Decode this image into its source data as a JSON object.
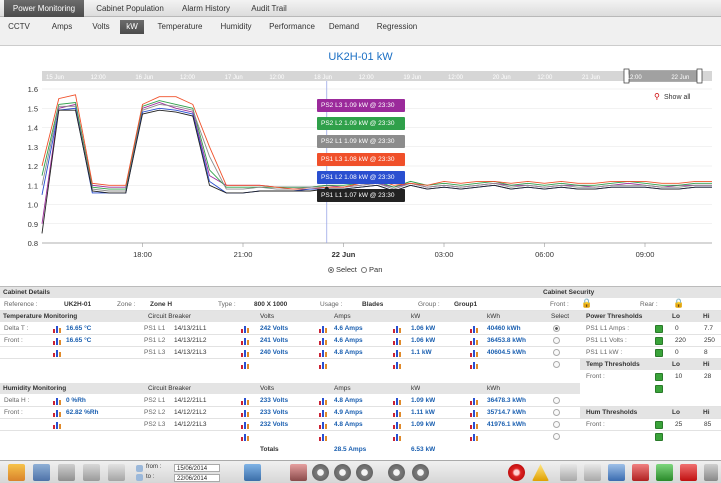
{
  "top_tabs": [
    {
      "label": "Power Monitoring",
      "active": true
    },
    {
      "label": "Cabinet Population"
    },
    {
      "label": "Alarm History"
    },
    {
      "label": "Audit Trail"
    }
  ],
  "sub_tabs": [
    {
      "label": "CCTV"
    },
    {
      "label": "Amps"
    },
    {
      "label": "Volts"
    },
    {
      "label": "kW",
      "active": true
    },
    {
      "label": "Temperature"
    },
    {
      "label": "Humidity"
    },
    {
      "label": "Performance"
    },
    {
      "label": "Demand"
    },
    {
      "label": "Regression"
    }
  ],
  "chart": {
    "title": "UK2H-01 kW",
    "show_all": "Show all",
    "select_label": "Select",
    "pan_label": "Pan",
    "tooltips": [
      {
        "text": "PS2 L3 1.09 kW @ 23:30",
        "color": "#9b2a9b"
      },
      {
        "text": "PS2 L2 1.09 kW @ 23:30",
        "color": "#2fa04a"
      },
      {
        "text": "PS2 L1 1.09 kW @ 23:30",
        "color": "#8c8c8c"
      },
      {
        "text": "PS1 L3 1.08 kW @ 23:30",
        "color": "#f0502a"
      },
      {
        "text": "PS1 L2 1.08 kW @ 23:30",
        "color": "#2a4fd0"
      },
      {
        "text": "PS1 L1 1.07 kW @ 23:30",
        "color": "#222222"
      }
    ],
    "navigator_labels": [
      "15 Jun",
      "12:00",
      "16 Jun",
      "12:00",
      "17 Jun",
      "12:00",
      "18 Jun",
      "12:00",
      "19 Jun",
      "12:00",
      "20 Jun",
      "12:00",
      "21 Jun",
      "12:00",
      "22 Jun"
    ]
  },
  "chart_data": {
    "type": "line",
    "ylim": [
      0.8,
      1.6
    ],
    "y_ticks": [
      "0.8",
      "0.9",
      "1.0",
      "1.1",
      "1.2",
      "1.3",
      "1.4",
      "1.5",
      "1.6"
    ],
    "x_ticks": [
      "18:00",
      "21:00",
      "22 Jun",
      "03:00",
      "06:00",
      "09:00"
    ],
    "x": [
      15.0,
      15.5,
      16.0,
      16.5,
      17.0,
      17.5,
      18.0,
      18.5,
      19.0,
      19.5,
      20.0,
      20.5,
      21.0,
      21.5,
      22.0,
      22.5,
      23.0,
      23.5,
      24.0,
      24.5,
      25.0,
      25.5,
      26.0,
      26.5,
      27.0,
      27.5,
      28.0,
      28.5,
      29.0,
      29.5,
      30.0,
      30.5,
      31.0,
      31.5,
      32.0,
      32.5,
      33.0,
      33.5,
      34.0,
      34.5,
      35.0
    ],
    "series": [
      {
        "name": "PS2 L3",
        "color": "#9b2a9b",
        "values": [
          0.9,
          1.5,
          1.52,
          1.1,
          1.09,
          1.09,
          1.5,
          1.53,
          1.5,
          1.48,
          1.15,
          1.1,
          1.1,
          1.1,
          1.09,
          1.09,
          1.09,
          1.1,
          1.09,
          1.1,
          1.11,
          1.09,
          1.11,
          1.09,
          1.1,
          1.09,
          1.1,
          1.11,
          1.1,
          1.1,
          1.09,
          1.1,
          1.1,
          1.09,
          1.1,
          1.11,
          1.1,
          1.09,
          1.1,
          1.1,
          1.1
        ]
      },
      {
        "name": "PS2 L2",
        "color": "#2fa04a",
        "values": [
          1.15,
          1.52,
          1.53,
          1.09,
          1.08,
          1.08,
          1.51,
          1.54,
          1.52,
          1.5,
          1.18,
          1.09,
          1.09,
          1.09,
          1.09,
          1.09,
          1.09,
          1.1,
          1.1,
          1.11,
          1.12,
          1.09,
          1.12,
          1.1,
          1.11,
          1.1,
          1.11,
          1.12,
          1.1,
          1.11,
          1.1,
          1.11,
          1.1,
          1.1,
          1.11,
          1.12,
          1.11,
          1.1,
          1.1,
          1.11,
          1.11
        ]
      },
      {
        "name": "PS2 L1",
        "color": "#8c8c8c",
        "values": [
          1.1,
          1.51,
          1.51,
          1.08,
          1.07,
          1.07,
          1.49,
          1.52,
          1.51,
          1.49,
          1.25,
          1.08,
          1.08,
          1.09,
          1.08,
          1.08,
          1.09,
          1.09,
          1.09,
          1.1,
          1.11,
          1.08,
          1.11,
          1.09,
          1.1,
          1.09,
          1.1,
          1.11,
          1.09,
          1.1,
          1.09,
          1.1,
          1.09,
          1.09,
          1.1,
          1.1,
          1.1,
          1.09,
          1.09,
          1.1,
          1.1
        ]
      },
      {
        "name": "PS1 L3",
        "color": "#f0502a",
        "values": [
          1.2,
          1.55,
          1.57,
          1.11,
          1.1,
          1.1,
          1.52,
          1.56,
          1.56,
          1.52,
          1.3,
          1.1,
          1.1,
          1.1,
          1.09,
          1.08,
          1.08,
          1.09,
          1.09,
          1.11,
          1.13,
          1.1,
          1.11,
          1.1,
          1.12,
          1.11,
          1.12,
          1.12,
          1.11,
          1.12,
          1.11,
          1.12,
          1.11,
          1.11,
          1.12,
          1.12,
          1.12,
          1.11,
          1.11,
          1.12,
          1.12
        ]
      },
      {
        "name": "PS1 L2",
        "color": "#2a4fd0",
        "values": [
          1.05,
          1.49,
          1.5,
          1.06,
          1.06,
          1.06,
          1.48,
          1.5,
          1.49,
          1.47,
          1.12,
          1.06,
          1.06,
          1.07,
          1.07,
          1.07,
          1.08,
          1.08,
          1.08,
          1.09,
          1.1,
          1.07,
          1.1,
          1.08,
          1.09,
          1.08,
          1.09,
          1.1,
          1.08,
          1.09,
          1.08,
          1.09,
          1.08,
          1.08,
          1.09,
          1.09,
          1.09,
          1.08,
          1.08,
          1.09,
          1.09
        ]
      },
      {
        "name": "PS1 L1",
        "color": "#222222",
        "values": [
          0.85,
          1.49,
          1.49,
          1.07,
          1.06,
          1.06,
          1.47,
          1.49,
          1.48,
          1.46,
          1.1,
          1.06,
          1.06,
          1.07,
          1.07,
          1.07,
          1.07,
          1.08,
          1.08,
          1.09,
          1.1,
          1.07,
          1.1,
          1.08,
          1.09,
          1.08,
          1.09,
          1.1,
          1.08,
          1.09,
          1.08,
          1.09,
          1.08,
          1.08,
          1.09,
          1.09,
          1.09,
          1.08,
          1.08,
          1.09,
          1.09
        ]
      }
    ]
  },
  "details": {
    "cabinet_details": "Cabinet Details",
    "cabinet_security": "Cabinet Security",
    "reference_label": "Reference :",
    "reference": "UK2H-01",
    "zone_label": "Zone :",
    "zone": "Zone H",
    "type_label": "Type :",
    "type": "800 X 1000",
    "usage_label": "Usage :",
    "usage": "Blades",
    "group_label": "Group :",
    "group": "Group1",
    "front_label": "Front :",
    "rear_label": "Rear :",
    "temp_monitoring": "Temperature Monitoring",
    "humidity_monitoring": "Humidity Monitoring",
    "delta_t": "Delta T :",
    "delta_t_val": "16.65 °C",
    "front_t": "Front :",
    "front_t_val": "16.65 °C",
    "delta_h": "Delta H :",
    "delta_h_val": "0 %Rh",
    "front_h": "Front :",
    "front_h_val": "62.82 %Rh",
    "hdr_cb": "Circuit Breaker",
    "hdr_volts": "Volts",
    "hdr_amps": "Amps",
    "hdr_kw": "kW",
    "hdr_kwh": "kWh",
    "hdr_select": "Select",
    "ps1_rows": [
      {
        "name": "PS1 L1",
        "cb": "14/13/21L1",
        "volts": "242 Volts",
        "amps": "4.6 Amps",
        "kw": "1.06 kW",
        "kwh": "40460 kWh"
      },
      {
        "name": "PS1 L2",
        "cb": "14/13/21L2",
        "volts": "241 Volts",
        "amps": "4.6 Amps",
        "kw": "1.06 kW",
        "kwh": "36453.8 kWh"
      },
      {
        "name": "PS1 L3",
        "cb": "14/13/21L3",
        "volts": "240 Volts",
        "amps": "4.8 Amps",
        "kw": "1.1 kW",
        "kwh": "40604.5 kWh"
      }
    ],
    "ps2_rows": [
      {
        "name": "PS2 L1",
        "cb": "14/12/21L1",
        "volts": "233 Volts",
        "amps": "4.8 Amps",
        "kw": "1.09 kW",
        "kwh": "36478.3 kWh"
      },
      {
        "name": "PS2 L2",
        "cb": "14/12/21L2",
        "volts": "233 Volts",
        "amps": "4.9 Amps",
        "kw": "1.11 kW",
        "kwh": "35714.7 kWh"
      },
      {
        "name": "PS2 L3",
        "cb": "14/12/21L3",
        "volts": "232 Volts",
        "amps": "4.8 Amps",
        "kw": "1.09 kW",
        "kwh": "41976.1 kWh"
      }
    ],
    "totals_label": "Totals",
    "totals_amps": "28.5 Amps",
    "totals_kw": "6.53 kW",
    "power_thresholds": "Power Thresholds",
    "lo": "Lo",
    "hi": "Hi",
    "pt_rows": [
      {
        "label": "PS1 L1 Amps :",
        "lo": "0",
        "hi": "7.7"
      },
      {
        "label": "PS1 L1 Volts :",
        "lo": "220",
        "hi": "250"
      },
      {
        "label": "PS1 L1 kW :",
        "lo": "0",
        "hi": "8"
      }
    ],
    "temp_thresholds": "Temp Thresholds",
    "tt_front": "Front :",
    "tt_lo": "10",
    "tt_hi": "28",
    "hum_thresholds": "Hum Thresholds",
    "ht_front": "Front :",
    "ht_lo": "25",
    "ht_hi": "85"
  },
  "toolbar": {
    "from_label": "from :",
    "from_date": "15/06/2014",
    "to_label": "to :",
    "to_date": "22/06/2014"
  }
}
